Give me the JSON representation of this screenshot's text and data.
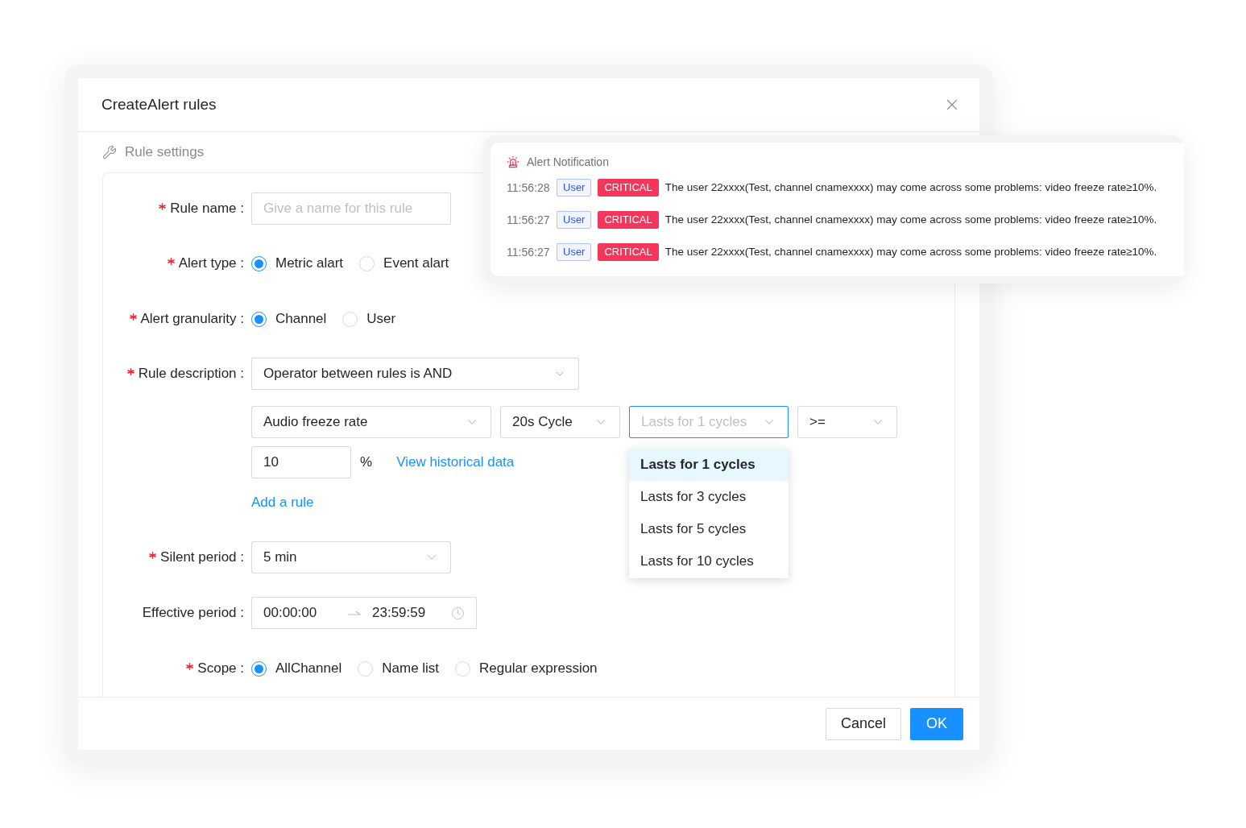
{
  "dialog": {
    "title": "CreateAlert rules",
    "section_title": "Rule settings",
    "fields": [
      {
        "kind": "text",
        "label": "Rule name :",
        "required": true,
        "placeholder": "Give a name for this rule"
      },
      {
        "kind": "radio",
        "label": "Alert type :",
        "required": true,
        "options": [
          {
            "label": "Metric alart",
            "selected": true
          },
          {
            "label": "Event alart",
            "selected": false
          }
        ]
      },
      {
        "kind": "radio",
        "label": "Alert granularity :",
        "required": true,
        "options": [
          {
            "label": "Channel",
            "selected": true
          },
          {
            "label": "User",
            "selected": false
          }
        ]
      },
      {
        "kind": "rules",
        "label": "Rule description :",
        "required": true,
        "operator": "Operator between rules is AND",
        "conditions": [
          {
            "metric": "Audio freeze rate",
            "cycle": "20s Cycle",
            "duration": {
              "placeholder": "Lasts for 1 cycles",
              "focused": true,
              "open": true,
              "options": [
                {
                  "label": "Lasts for 1 cycles",
                  "selected": true
                },
                {
                  "label": "Lasts for 3 cycles",
                  "selected": false
                },
                {
                  "label": "Lasts for 5 cycles",
                  "selected": false
                },
                {
                  "label": "Lasts for 10 cycles",
                  "selected": false
                }
              ]
            },
            "comparator": ">=",
            "threshold": "10",
            "unit": "%",
            "link": "View historical data"
          }
        ],
        "add_link": "Add a rule"
      },
      {
        "kind": "select",
        "label": "Silent period :",
        "required": true,
        "value": "5 min"
      },
      {
        "kind": "time_range",
        "label": "Effective period :",
        "required": false,
        "start": "00:00:00",
        "end": "23:59:59"
      },
      {
        "kind": "radio",
        "label": "Scope :",
        "required": true,
        "options": [
          {
            "label": "AllChannel",
            "selected": true
          },
          {
            "label": "Name list",
            "selected": false
          },
          {
            "label": "Regular expression",
            "selected": false
          }
        ]
      }
    ],
    "buttons": [
      {
        "label": "Cancel",
        "kind": "default"
      },
      {
        "label": "OK",
        "kind": "primary"
      }
    ]
  },
  "notification": {
    "title": "Alert Notification",
    "rows": [
      {
        "time": "11:56:28",
        "tag": "User",
        "level": "CRITICAL",
        "message": "The user 22xxxx(Test, channel cnamexxxx) may come across some problems: video freeze rate≥10%."
      },
      {
        "time": "11:56:27",
        "tag": "User",
        "level": "CRITICAL",
        "message": "The user 22xxxx(Test, channel cnamexxxx) may come across some problems: video freeze rate≥10%."
      },
      {
        "time": "11:56:27",
        "tag": "User",
        "level": "CRITICAL",
        "message": "The user 22xxxx(Test, channel cnamexxxx) may come across some problems: video freeze rate≥10%."
      }
    ]
  }
}
